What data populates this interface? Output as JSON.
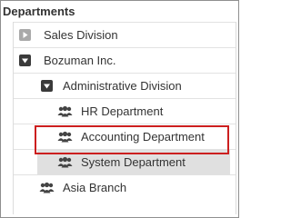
{
  "header": {
    "title": "Departments"
  },
  "tree": {
    "items": [
      {
        "label": "Sales Division",
        "icon": "expand-icon"
      },
      {
        "label": "Bozuman Inc.",
        "icon": "collapse-icon"
      },
      {
        "label": "Administrative Division",
        "icon": "collapse-icon"
      },
      {
        "label": "HR Department",
        "icon": "group-icon"
      },
      {
        "label": "Accounting Department",
        "icon": "group-icon"
      },
      {
        "label": "System Department",
        "icon": "group-icon",
        "selected": true
      },
      {
        "label": "Asia Branch",
        "icon": "group-icon"
      }
    ]
  },
  "colors": {
    "highlight_border": "#cc1f1f",
    "selected_background": "#e0e0e0",
    "text": "#333333"
  }
}
